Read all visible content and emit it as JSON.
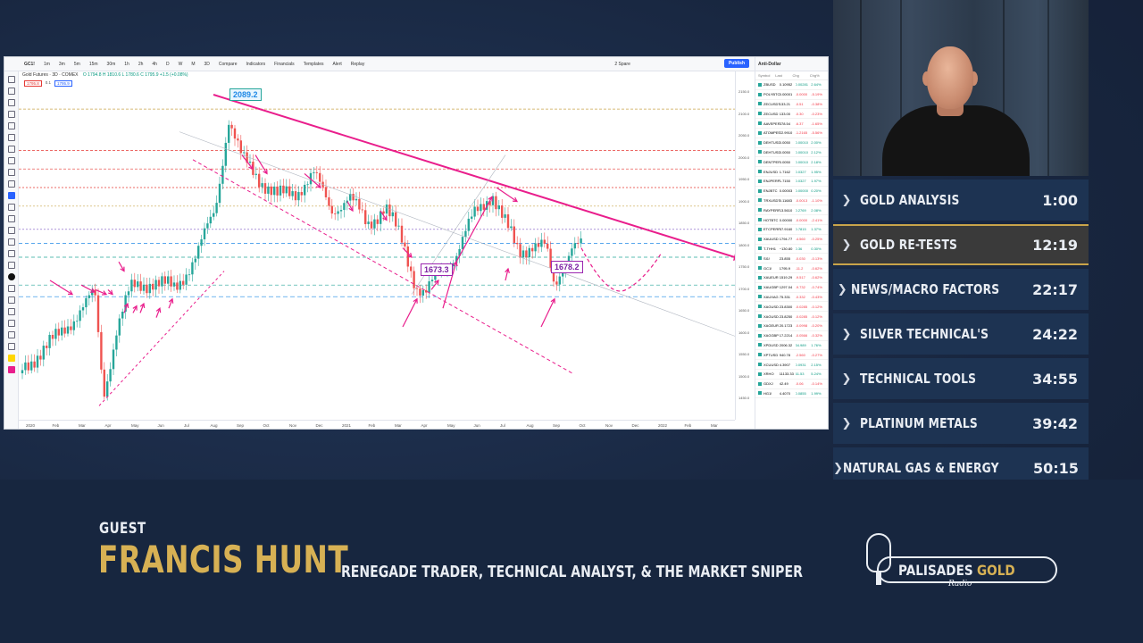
{
  "chart_window": {
    "toolbar": {
      "symbol": "GC1!",
      "intervals": [
        "1m",
        "3m",
        "5m",
        "15m",
        "30m",
        "1h",
        "2h",
        "4h",
        "D",
        "W",
        "M",
        "3D"
      ],
      "compare": "Compare",
      "indicators": "Indicators",
      "financials": "Financials",
      "templates": "Templates",
      "alert": "Alert",
      "replay": "Replay",
      "layout": "2 Spare",
      "publish": "Publish"
    },
    "legend": {
      "title": "Gold Futures · 3D · COMEX",
      "ohlc": "O 1794.8 H 1810.6 L 1780.6 C 1795.9 +1.5 (+0.08%)",
      "pill_sell": "1795.8",
      "pill_mid": "0.1",
      "pill_buy": "1795.9"
    },
    "callouts": {
      "high": "2089.2",
      "low1": "1673.3",
      "low2": "1678.2"
    },
    "y_ticks": [
      "2150.0",
      "2100.0",
      "2050.0",
      "2000.0",
      "1950.0",
      "1900.0",
      "1850.0",
      "1800.0",
      "1750.0",
      "1700.0",
      "1650.0",
      "1600.0",
      "1550.0",
      "1500.0",
      "1450.0"
    ],
    "x_ticks": [
      "2020",
      "Feb",
      "Mar",
      "Apr",
      "May",
      "Jun",
      "Jul",
      "Aug",
      "Sep",
      "Oct",
      "Nov",
      "Dec",
      "2021",
      "Feb",
      "Mar",
      "Apr",
      "May",
      "Jun",
      "Jul",
      "Aug",
      "Sep",
      "Oct",
      "Nov",
      "Dec",
      "2022",
      "Feb",
      "Mar"
    ],
    "watchlist": {
      "title": "Anti-Dollar",
      "head": [
        "Symbol",
        "Last",
        "Chg",
        "Chg%"
      ],
      "rows": [
        {
          "sym": "ZBUSD",
          "last": "0.10952",
          "chg": "0.00281",
          "pct": "2.64%",
          "dir": "up"
        },
        {
          "sym": "POLYBTC",
          "last": "0.00001",
          "chg": "-0.0000",
          "pct": "-5.19%",
          "dir": "dn"
        },
        {
          "sym": "ZECUSDT",
          "last": "133.21",
          "chg": "-0.51",
          "pct": "-0.38%",
          "dir": "dn"
        },
        {
          "sym": "ZECUSD",
          "last": "133.00",
          "chg": "-0.30",
          "pct": "-0.23%",
          "dir": "dn"
        },
        {
          "sym": "AAVEPERP",
          "last": "378.54",
          "chg": "-6.37",
          "pct": "-1.65%",
          "dir": "dn"
        },
        {
          "sym": "ATOMPERP",
          "last": "22.9910",
          "chg": "-1.2165",
          "pct": "-5.56%",
          "dir": "dn"
        },
        {
          "sym": "DEHTUSD",
          "last": "0.0050",
          "chg": "0.00010",
          "pct": "2.00%",
          "dir": "up"
        },
        {
          "sym": "DEHTUSDT",
          "last": "0.0050",
          "chg": "0.00010",
          "pct": "2.12%",
          "dir": "up"
        },
        {
          "sym": "DENTPERP",
          "last": "0.0050",
          "chg": "0.00010",
          "pct": "2.18%",
          "dir": "up"
        },
        {
          "sym": "ENJUSD",
          "last": "1.7162",
          "chg": "0.0327",
          "pct": "1.95%",
          "dir": "up"
        },
        {
          "sym": "ENJPERP",
          "last": "1.7150",
          "chg": "0.0327",
          "pct": "1.97%",
          "dir": "up"
        },
        {
          "sym": "ENJBTC",
          "last": "0.00003",
          "chg": "0.00000",
          "pct": "0.20%",
          "dir": "up"
        },
        {
          "sym": "TRXUSDT",
          "last": "0.11683",
          "chg": "-0.0013",
          "pct": "-1.10%",
          "dir": "dn"
        },
        {
          "sym": "RAYPERP",
          "last": "13.5610",
          "chg": "0.2769",
          "pct": "2.08%",
          "dir": "up"
        },
        {
          "sym": "HOTBTC",
          "last": "0.00000",
          "chg": "-0.0000",
          "pct": "-2.41%",
          "dir": "dn"
        },
        {
          "sym": "ETCPERP",
          "last": "57.9160",
          "chg": "0.7815",
          "pct": "1.37%",
          "dir": "up"
        },
        {
          "sym": "XAUUSD",
          "last": "1794.77",
          "chg": "-4.560",
          "pct": "-0.25%",
          "dir": "dn"
        },
        {
          "sym": "T-THH1",
          "last": "~130.80",
          "chg": "0.36",
          "pct": "0.30%",
          "dir": "up"
        },
        {
          "sym": "SI1!",
          "last": "23.855",
          "chg": "-0.030",
          "pct": "-0.13%",
          "dir": "dn"
        },
        {
          "sym": "GC1!",
          "last": "1795.9",
          "chg": "-11.2",
          "pct": "-0.62%",
          "dir": "dn"
        },
        {
          "sym": "XAUEUR",
          "last": "1519.29",
          "chg": "-9.517",
          "pct": "-0.62%",
          "dir": "dn"
        },
        {
          "sym": "XAUGBP",
          "last": "1297.04",
          "chg": "-9.732",
          "pct": "-0.74%",
          "dir": "dn"
        },
        {
          "sym": "XAUXAG",
          "last": "75.331",
          "chg": "-0.332",
          "pct": "-0.43%",
          "dir": "dn"
        },
        {
          "sym": "XAGUSD",
          "last": "23.8300",
          "chg": "-0.0285",
          "pct": "-0.12%",
          "dir": "dn"
        },
        {
          "sym": "XAGUSD",
          "last": "23.8250",
          "chg": "-0.0285",
          "pct": "-0.12%",
          "dir": "dn"
        },
        {
          "sym": "XAGEUR",
          "last": "20.1723",
          "chg": "-0.0998",
          "pct": "-0.20%",
          "dir": "dn"
        },
        {
          "sym": "XAGGBP",
          "last": "17.2214",
          "chg": "-0.0566",
          "pct": "-0.32%",
          "dir": "dn"
        },
        {
          "sym": "XPDUSD",
          "last": "2006.32",
          "chg": "34.989",
          "pct": "1.76%",
          "dir": "up"
        },
        {
          "sym": "XPTUSD",
          "last": "940.78",
          "chg": "-2.560",
          "pct": "-0.27%",
          "dir": "dn"
        },
        {
          "sym": "XCUUSD",
          "last": "4.3907",
          "chg": "0.0931",
          "pct": "2.15%",
          "dir": "up"
        },
        {
          "sym": "XRHO",
          "last": "11133.33",
          "chg": "61.53",
          "pct": "5.24%",
          "dir": "up"
        },
        {
          "sym": "GDXJ",
          "last": "42.49",
          "chg": "-0.06",
          "pct": "-0.14%",
          "dir": "dn"
        },
        {
          "sym": "HG1!",
          "last": "4.4070",
          "chg": "0.0855",
          "pct": "1.99%",
          "dir": "up"
        }
      ]
    }
  },
  "topics": [
    {
      "label": "GOLD ANALYSIS",
      "time": "1:00",
      "active": false
    },
    {
      "label": "GOLD RE-TESTS",
      "time": "12:19",
      "active": true
    },
    {
      "label": "NEWS/MACRO FACTORS",
      "time": "22:17",
      "active": false
    },
    {
      "label": "SILVER TECHNICAL'S",
      "time": "24:22",
      "active": false
    },
    {
      "label": "TECHNICAL TOOLS",
      "time": "34:55",
      "active": false
    },
    {
      "label": "PLATINUM METALS",
      "time": "39:42",
      "active": false
    },
    {
      "label": "NATURAL GAS & ENERGY",
      "time": "50:15",
      "active": false
    }
  ],
  "lower_third": {
    "guest_label": "GUEST",
    "guest_name": "FRANCIS HUNT",
    "guest_title": "RENEGADE TRADER, TECHNICAL ANALYST, & THE MARKET SNIPER"
  },
  "logo": {
    "word1": "PALISADES",
    "word2": "GOLD",
    "sub": "Radio"
  },
  "colors": {
    "accent_gold": "#d7b154",
    "navy": "#17263f",
    "trendline": "#e91e8c",
    "bull": "#26a69a",
    "bear": "#ef5350"
  }
}
